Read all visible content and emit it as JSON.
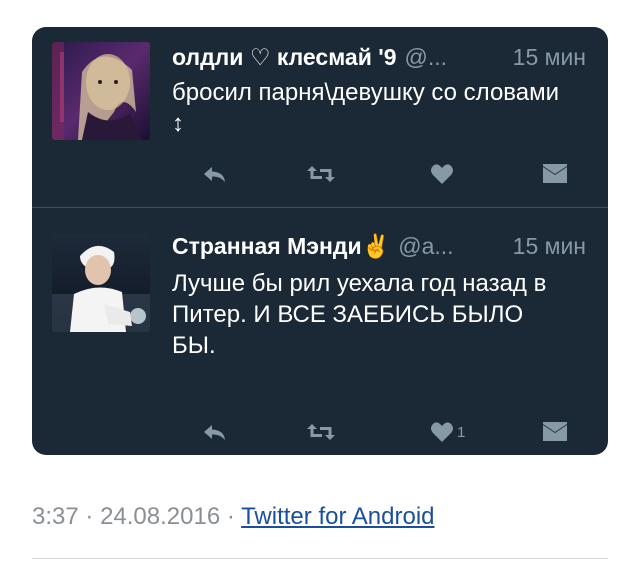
{
  "tweets": [
    {
      "name": "олдли ♡ клесмай '9",
      "handle": "@...",
      "time": "15 мин",
      "text": "бросил парня\\девушку со словами ↕",
      "likes": ""
    },
    {
      "name": "Странная Мэнди✌️",
      "handle": "@а...",
      "time": "15 мин",
      "text": "Лучше бы рил уехала год назад в Питер. И ВСЕ ЗАЕБИСЬ БЫЛО БЫ.",
      "likes": "1"
    }
  ],
  "footer": {
    "time": "3:37",
    "date": "24.08.2016",
    "separator": "·",
    "source": "Twitter for Android"
  },
  "icons": [
    "reply-icon",
    "retweet-icon",
    "heart-icon",
    "direct-message-icon"
  ],
  "colors": {
    "card_bg": "#1b2836",
    "secondary_text": "#8899a6",
    "link": "#1b4f9c"
  }
}
